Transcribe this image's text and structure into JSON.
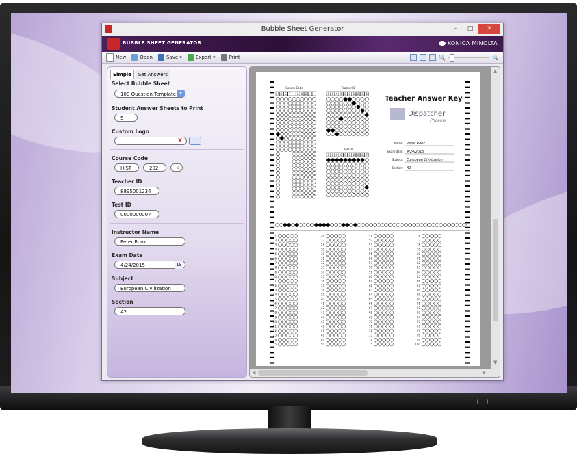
{
  "window": {
    "title": "Bubble Sheet Generator",
    "controls": [
      "–",
      "□",
      "✕"
    ]
  },
  "banner": {
    "app_name": "BUBBLE SHEET GENERATOR",
    "brand": "KONICA MINOLTA"
  },
  "toolbar": {
    "new": "New",
    "open": "Open",
    "save": "Save ▾",
    "export": "Export ▾",
    "print": "Print"
  },
  "tabs": [
    "Simple",
    "Set Answers"
  ],
  "form": {
    "select_sheet_label": "Select Bubble Sheet",
    "select_sheet_value": "100 Question Template",
    "sheets_to_print_label": "Student Answer Sheets to Print",
    "sheets_to_print_value": "5",
    "custom_logo_label": "Custom Logo",
    "custom_logo_clear": "X",
    "custom_logo_browse": "...",
    "course_code_label": "Course Code",
    "course_code_1": "HIST",
    "course_code_2": "202",
    "course_code_3": "A",
    "teacher_id_label": "Teacher ID",
    "teacher_id_value": "8895001234",
    "test_id_label": "Test ID",
    "test_id_value": "0000000007",
    "instructor_label": "Instructor Name",
    "instructor_value": "Peter Rook",
    "exam_date_label": "Exam Date",
    "exam_date_value": "4/24/2015",
    "calendar_icon": "15",
    "subject_label": "Subject",
    "subject_value": "European Civilization",
    "section_label": "Section",
    "section_value": "A2"
  },
  "sheet": {
    "course_code_header": "Course Code",
    "teacher_id_header": "Teacher ID",
    "test_id_header": "Test ID",
    "title": "Teacher Answer Key",
    "logo_word": "Dispatcher",
    "logo_sub": "Phoenix",
    "info_labels": [
      "Name:",
      "Exam date:",
      "Subject:",
      "Section:"
    ],
    "info_values": [
      "Peter Rook",
      "4/24/2015",
      "European Civilization",
      "A2"
    ],
    "course_code_boxes": [
      "H",
      "I",
      "S",
      "T",
      "",
      "2",
      "0",
      "2",
      "",
      ""
    ],
    "teacher_id_boxes": [
      "8",
      "8",
      "9",
      "5",
      "0",
      "0",
      "1",
      "2",
      "3",
      "4"
    ],
    "test_id_boxes": [
      "0",
      "0",
      "0",
      "0",
      "0",
      "0",
      "0",
      "0",
      "0",
      "7"
    ],
    "question_numbers_col1": [
      "1",
      "2",
      "3",
      "4",
      "5",
      "6",
      "7",
      "8",
      "9",
      "10",
      "11",
      "12",
      "13",
      "14",
      "15",
      "16",
      "17",
      "18",
      "19",
      "20",
      "21",
      "22",
      "23",
      "24",
      "25"
    ],
    "question_numbers_col2": [
      "26",
      "27",
      "28",
      "29",
      "30",
      "31",
      "32",
      "33",
      "34",
      "35",
      "36",
      "37",
      "38",
      "39",
      "40",
      "41",
      "42",
      "43",
      "44",
      "45",
      "46",
      "47",
      "48",
      "49",
      "50"
    ],
    "question_numbers_col3": [
      "51",
      "52",
      "53",
      "54",
      "55",
      "56",
      "57",
      "58",
      "59",
      "60",
      "61",
      "62",
      "63",
      "64",
      "65",
      "66",
      "67",
      "68",
      "69",
      "70",
      "71",
      "72",
      "73",
      "74",
      "75"
    ],
    "question_numbers_col4": [
      "76",
      "77",
      "78",
      "79",
      "80",
      "81",
      "82",
      "83",
      "84",
      "85",
      "86",
      "87",
      "88",
      "89",
      "90",
      "91",
      "92",
      "93",
      "94",
      "95",
      "96",
      "97",
      "98",
      "99",
      "100"
    ]
  }
}
